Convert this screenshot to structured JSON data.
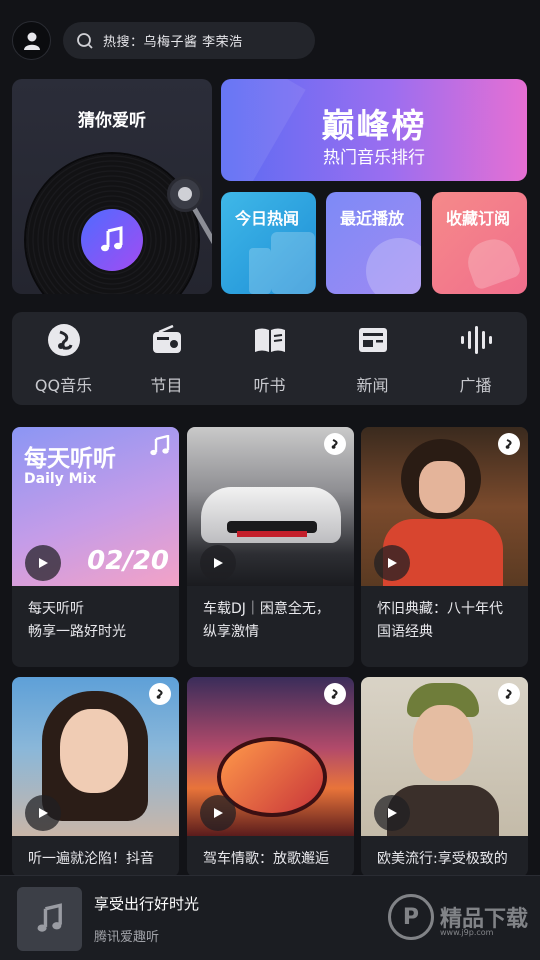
{
  "search": {
    "text": "热搜：乌梅子酱 李荣浩"
  },
  "guess": {
    "title": "猜你爱听"
  },
  "peak": {
    "logo_text": "巅峰榜",
    "subtitle": "热门音乐排行"
  },
  "mini_cards": [
    {
      "title": "今日热闻",
      "color": "#2ea5e0"
    },
    {
      "title": "最近播放",
      "color": "#8e89f5"
    },
    {
      "title": "收藏订阅",
      "color": "#f47b8b"
    }
  ],
  "categories": [
    {
      "label": "QQ音乐",
      "icon": "qq-music-icon"
    },
    {
      "label": "节目",
      "icon": "radio-icon"
    },
    {
      "label": "听书",
      "icon": "book-icon"
    },
    {
      "label": "新闻",
      "icon": "news-icon"
    },
    {
      "label": "广播",
      "icon": "broadcast-icon"
    }
  ],
  "daily": {
    "title": "每天听听",
    "subtitle": "Daily Mix",
    "date": "02/20"
  },
  "tiles": [
    {
      "text": "每天听听\n畅享一路好时光"
    },
    {
      "text": "车载DJ｜困意全无，纵享激情"
    },
    {
      "text": "怀旧典藏：八十年代国语经典"
    },
    {
      "text": "听一遍就沦陷！抖音"
    },
    {
      "text": "驾车情歌：放歌邂逅"
    },
    {
      "text": "欧美流行:享受极致的"
    }
  ],
  "player": {
    "title": "享受出行好时光",
    "subtitle": "腾讯爱趣听"
  },
  "watermark": {
    "text": "精品下载",
    "url": "www.j9p.com"
  }
}
